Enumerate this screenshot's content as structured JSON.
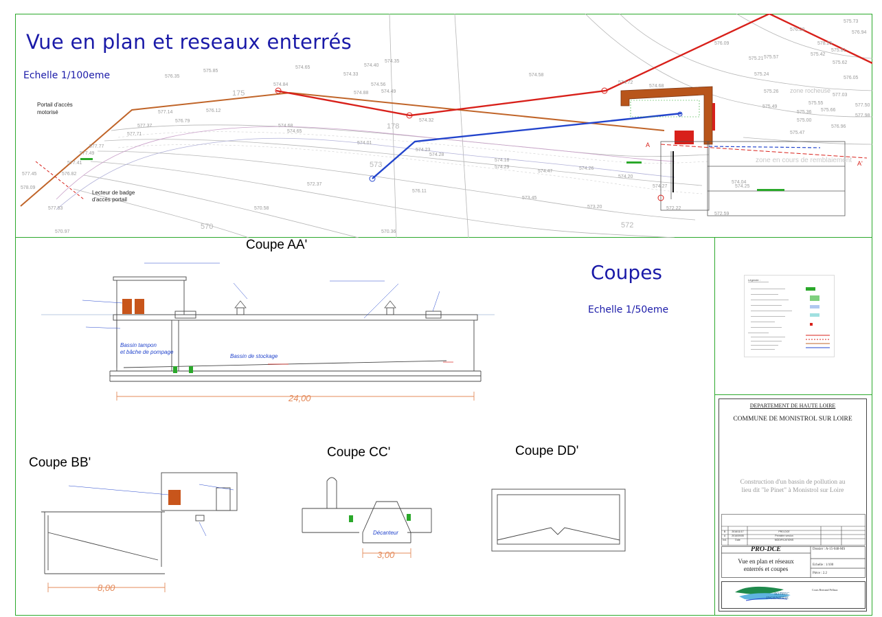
{
  "plan": {
    "title": "Vue en plan et reseaux enterrés",
    "scale": "Echelle 1/100eme",
    "portail_label_1": "Portail d'accès",
    "portail_label_2": "motorisé",
    "lecteur_label_1": "Lecteur de badge",
    "lecteur_label_2": "d'accès portail",
    "zone_remblai": "zone en cours de remblaiement",
    "zone_rocheuse": "zone rocheuse",
    "section_marks": [
      "A",
      "A'"
    ],
    "contours": [
      "175",
      "178",
      "570",
      "572",
      "573"
    ],
    "elevations": [
      "574.84",
      "574.65",
      "574.33",
      "574.88",
      "574.56",
      "574.49",
      "574.40",
      "574.35",
      "574.32",
      "574.23",
      "574.28",
      "574.18",
      "574.29",
      "574.47",
      "574.26",
      "574.20",
      "574.04",
      "574.25",
      "574.27",
      "574.58",
      "574.72",
      "574.68",
      "574.68",
      "574.65",
      "574.01",
      "576.12",
      "576.79",
      "577.14",
      "577.37",
      "577.71",
      "577.77",
      "577.49",
      "577.41",
      "576.82",
      "576.35",
      "575.85",
      "575.55",
      "575.66",
      "575.36",
      "575.00",
      "575.47",
      "575.49",
      "575.26",
      "575.24",
      "575.21",
      "575.57",
      "575.42",
      "575.81",
      "575.73",
      "575.62",
      "576.05",
      "576.94",
      "577.03",
      "576.96",
      "576.11",
      "573.45",
      "573.20",
      "572.22",
      "572.59",
      "572.37",
      "570.58",
      "570.36",
      "570.97",
      "577.53",
      "577.45",
      "578.09",
      "578.25",
      "576.09",
      "576.20",
      "577.50",
      "577.98"
    ]
  },
  "coupes": {
    "title": "Coupes",
    "scale": "Echelle 1/50eme",
    "aa": {
      "label": "Coupe AA'",
      "dimension": "24,00",
      "bassin_label": "Bassin de stockage",
      "pompage_label_1": "Bassin tampon",
      "pompage_label_2": "et bâche de pompage"
    },
    "bb": {
      "label": "Coupe BB'",
      "dimension": "8,00"
    },
    "cc": {
      "label": "Coupe CC'",
      "dimension": "3,00",
      "decanteur_label": "Décanteur"
    },
    "dd": {
      "label": "Coupe DD'"
    }
  },
  "cartouche": {
    "departement": "DEPARTEMENT DE HAUTE LOIRE",
    "commune": "COMMUNE DE MONISTROL SUR LOIRE",
    "project_line_1": "Construction d'un bassin de pollution au",
    "project_line_2": "lieu dit \"le Pinet\" à Monistrol sur Loire",
    "phase": "PRO-DCE",
    "sheet_title_1": "Vue en plan et réseaux",
    "sheet_title_2": "enterrés et coupes",
    "dossier": "Dossier : A-15-048-MS",
    "echelle": "Echelle : 1/100",
    "piece": "Pièce : 2.2",
    "company_1": "SOTREC",
    "company_2": "INGENIERIE",
    "address": "Cours Bertrand Pellaux",
    "revisions": [
      {
        "indice": "B",
        "date": "2016/11/17",
        "objet": "PRO-DCE"
      },
      {
        "indice": "A",
        "date": "2016/09/05",
        "objet": "Première version"
      },
      {
        "indice": "Ind.",
        "date": "Date",
        "objet": "MODIFICATIONS"
      }
    ]
  },
  "legend": {
    "title": "Légende :"
  },
  "colors": {
    "frame": "#2aa82a",
    "title_blue": "#1a1aa8",
    "red_network": "#d8201a",
    "brown_network": "#c06428",
    "blue_network": "#2244cc",
    "building": "#b8551b",
    "contour_grey": "#a8a8a8",
    "dimension_orange": "#e48a5a"
  }
}
